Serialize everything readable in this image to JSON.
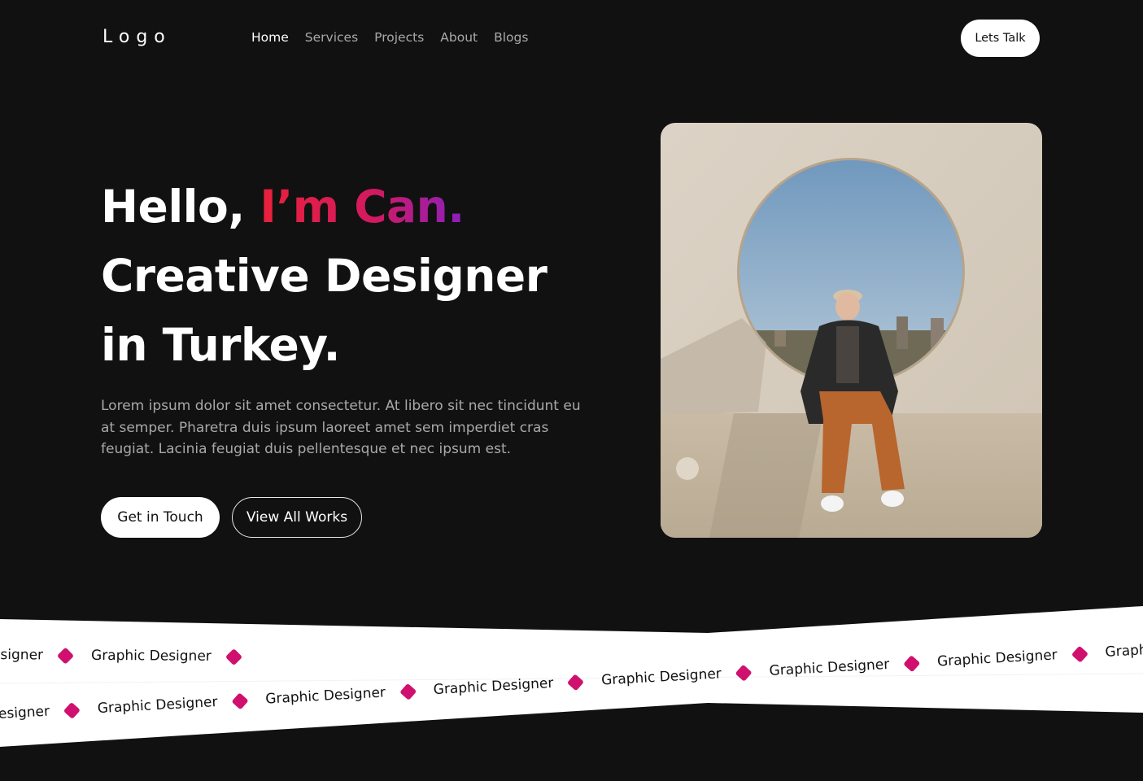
{
  "header": {
    "logo": "Logo",
    "nav": [
      "Home",
      "Services",
      "Projects",
      "About",
      "Blogs"
    ],
    "active_nav": "Home",
    "cta_label": "Lets Talk"
  },
  "hero": {
    "greeting_prefix": "Hello, ",
    "greeting_name": "I’m Can.",
    "line2": "Creative Designer",
    "line3": "in Turkey.",
    "description": "Lorem ipsum dolor sit amet consectetur. At libero sit nec tincidunt eu at semper. Pharetra duis ipsum laoreet amet sem imperdiet cras feugiat. Lacinia feugiat duis pellentesque et nec ipsum est.",
    "primary_button": "Get in Touch",
    "secondary_button": "View All Works"
  },
  "marquee": {
    "item_label": "Graphic Designer"
  },
  "colors": {
    "background": "#111111",
    "accent_pink": "#d0106e",
    "gradient_start": "#e8213a",
    "gradient_end": "#8a1fbf"
  }
}
